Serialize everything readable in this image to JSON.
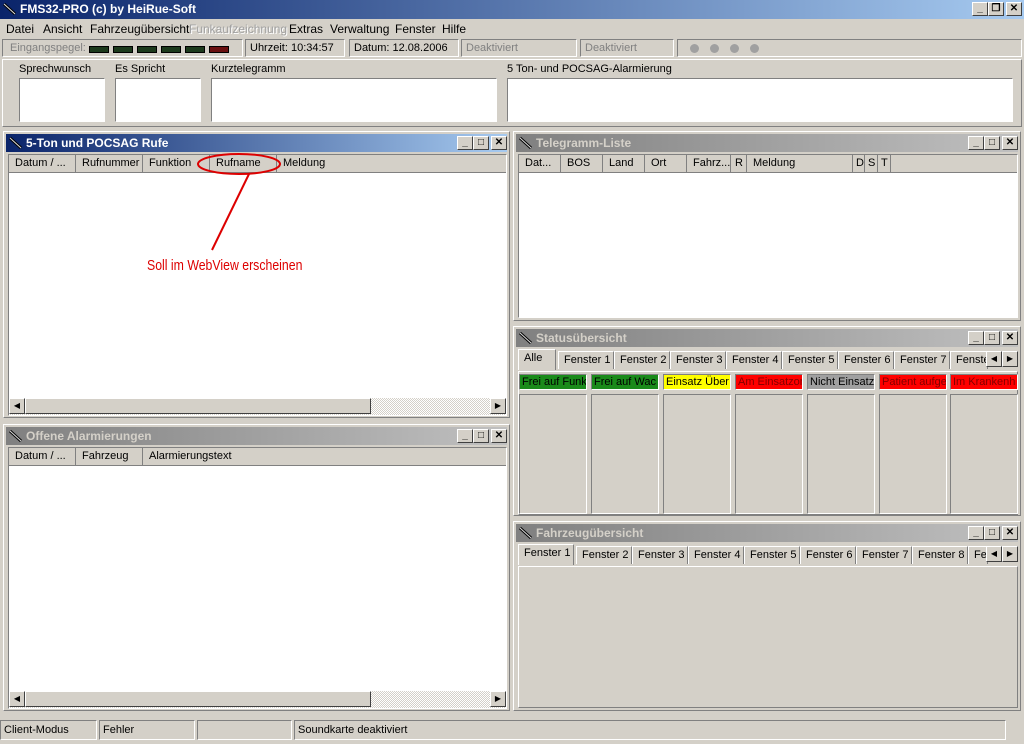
{
  "window": {
    "title": "FMS32-PRO (c) by HeiRue-Soft"
  },
  "menu": [
    {
      "label": "Datei",
      "disabled": false
    },
    {
      "label": "Ansicht",
      "disabled": false
    },
    {
      "label": "Fahrzeugübersicht",
      "disabled": false
    },
    {
      "label": "Funkaufzeichnung",
      "disabled": true
    },
    {
      "label": "Extras",
      "disabled": false
    },
    {
      "label": "Verwaltung",
      "disabled": false
    },
    {
      "label": "Fenster",
      "disabled": false
    },
    {
      "label": "Hilfe",
      "disabled": false
    }
  ],
  "toolbar": {
    "input_level_label": "Eingangspegel:",
    "time": "Uhrzeit: 10:34:57",
    "date": "Datum:  12.08.2006",
    "status1": "Deaktiviert",
    "status2": "Deaktiviert"
  },
  "top_labels": {
    "sprechwunsch": "Sprechwunsch",
    "es_spricht": "Es Spricht",
    "kurztelegramm": "Kurztelegramm",
    "alarm": "5 Ton- und POCSAG-Alarmierung"
  },
  "calls_window": {
    "title": "5-Ton und POCSAG Rufe",
    "columns": [
      "Datum / ...",
      "Rufnummer",
      "Funktion",
      "Rufname",
      "Meldung"
    ],
    "annotation": "Soll im WebView erscheinen"
  },
  "alarms_window": {
    "title": "Offene Alarmierungen",
    "columns": [
      "Datum / ...",
      "Fahrzeug",
      "Alarmierungstext"
    ]
  },
  "telegram_window": {
    "title": "Telegramm-Liste",
    "columns": [
      "Dat...",
      "BOS",
      "Land",
      "Ort",
      "Fahrz...",
      "R",
      "Meldung",
      "D",
      "S",
      "T"
    ]
  },
  "status_window": {
    "title": "Statusübersicht",
    "tabs": [
      "Alle",
      "Fenster 1",
      "Fenster 2",
      "Fenster 3",
      "Fenster 4",
      "Fenster 5",
      "Fenster 6",
      "Fenster 7",
      "Fenste"
    ],
    "statuses": [
      {
        "label": "Frei auf Funk",
        "bg": "#1a8a1a",
        "fg": "#000000"
      },
      {
        "label": "Frei auf Wac",
        "bg": "#1a8a1a",
        "fg": "#000000"
      },
      {
        "label": "Einsatz Über",
        "bg": "#ffff00",
        "fg": "#000000"
      },
      {
        "label": "Am Einsatzor",
        "bg": "#ff0000",
        "fg": "#800000"
      },
      {
        "label": "Nicht Einsatz",
        "bg": "#a0a0a0",
        "fg": "#000000"
      },
      {
        "label": "Patient aufge",
        "bg": "#ff0000",
        "fg": "#800000"
      },
      {
        "label": "Im Krankenh",
        "bg": "#ff0000",
        "fg": "#800000"
      }
    ]
  },
  "vehicle_window": {
    "title": "Fahrzeugübersicht",
    "tabs": [
      "Fenster 1",
      "Fenster 2",
      "Fenster 3",
      "Fenster 4",
      "Fenster 5",
      "Fenster 6",
      "Fenster 7",
      "Fenster 8",
      "Fe"
    ]
  },
  "statusbar": {
    "mode": "Client-Modus",
    "error": "Fehler",
    "empty": "",
    "sound": "Soundkarte deaktiviert"
  },
  "colors": {
    "active_caption": "#0a246a",
    "inactive_caption": "#808080",
    "annotation": "#dd0000"
  }
}
